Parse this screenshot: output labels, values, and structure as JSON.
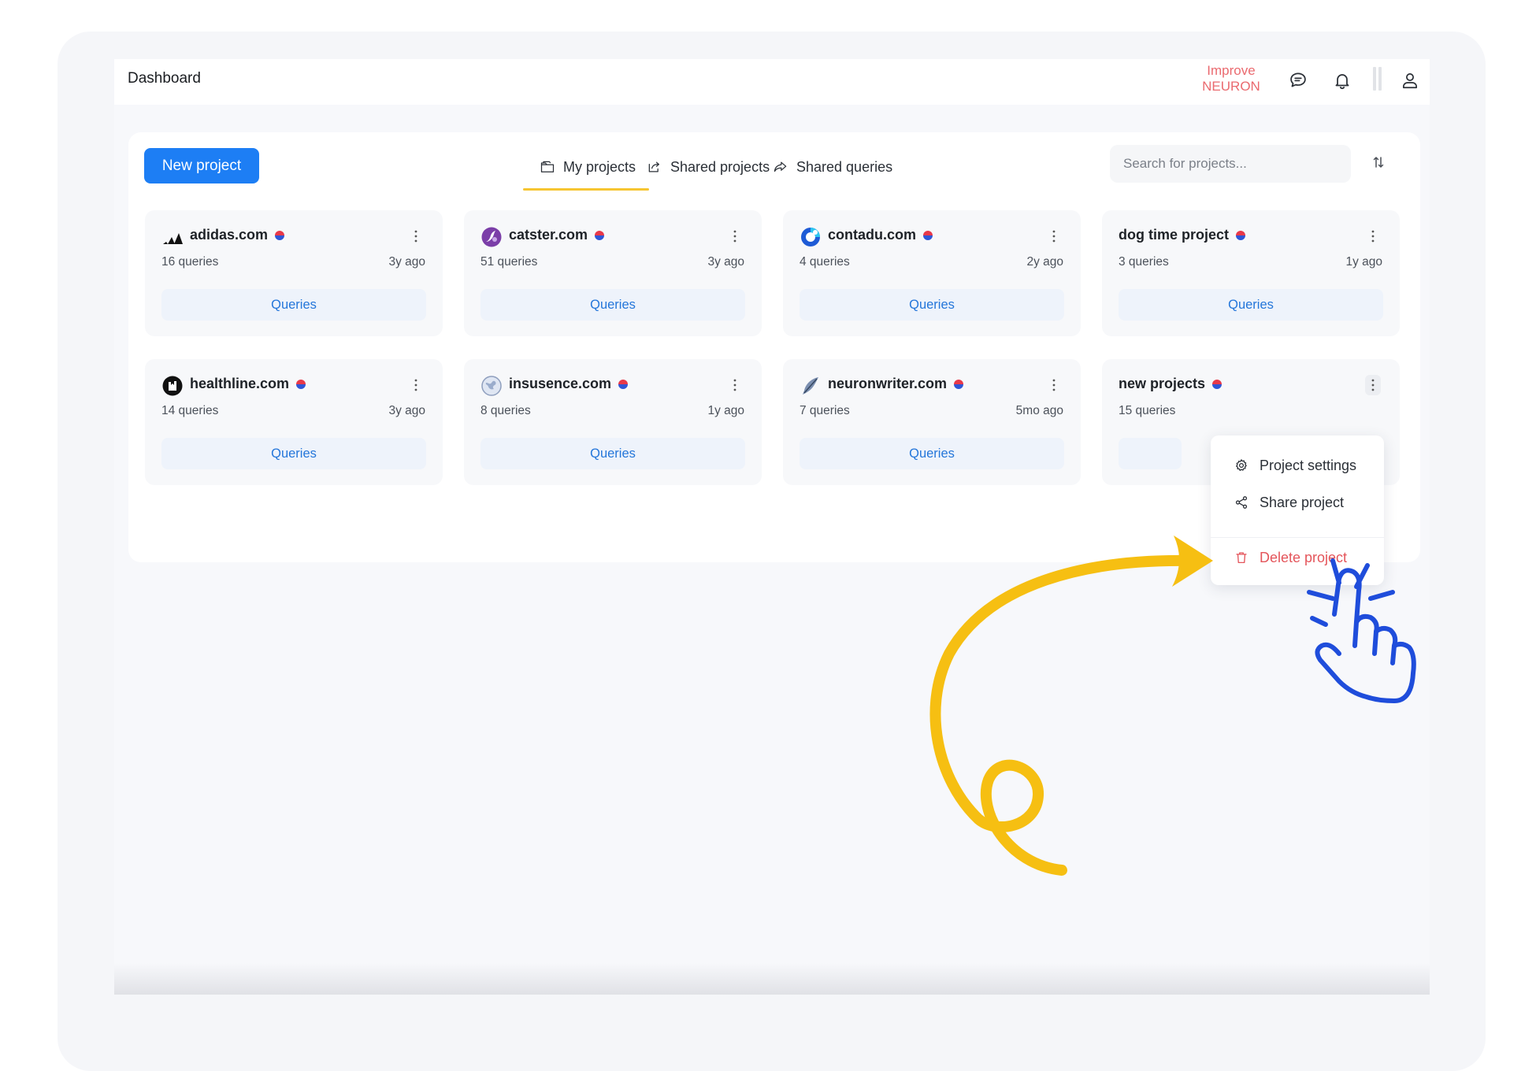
{
  "header": {
    "title": "Dashboard",
    "improve_line1": "Improve",
    "improve_line2": "NEURON"
  },
  "toolbar": {
    "new_project_label": "New project",
    "tabs": [
      {
        "label": "My projects",
        "icon": "folder-icon",
        "active": true
      },
      {
        "label": "Shared projects",
        "icon": "share-box-icon",
        "active": false
      },
      {
        "label": "Shared queries",
        "icon": "forward-arrow-icon",
        "active": false
      }
    ],
    "search_placeholder": "Search for projects..."
  },
  "projects": [
    {
      "name": "adidas.com",
      "queries": "16 queries",
      "ago": "3y ago",
      "button": "Queries",
      "icon": "adidas-logo"
    },
    {
      "name": "catster.com",
      "queries": "51 queries",
      "ago": "3y ago",
      "button": "Queries",
      "icon": "catster-logo"
    },
    {
      "name": "contadu.com",
      "queries": "4 queries",
      "ago": "2y ago",
      "button": "Queries",
      "icon": "contadu-logo"
    },
    {
      "name": "dog time project",
      "queries": "3 queries",
      "ago": "1y ago",
      "button": "Queries",
      "icon": ""
    },
    {
      "name": "healthline.com",
      "queries": "14 queries",
      "ago": "3y ago",
      "button": "Queries",
      "icon": "healthline-logo"
    },
    {
      "name": "insusence.com",
      "queries": "8 queries",
      "ago": "1y ago",
      "button": "Queries",
      "icon": "globe-logo"
    },
    {
      "name": "neuronwriter.com",
      "queries": "7 queries",
      "ago": "5mo ago",
      "button": "Queries",
      "icon": "feather-logo"
    },
    {
      "name": "new projects",
      "queries": "15 queries",
      "ago": "",
      "button": "",
      "icon": ""
    }
  ],
  "context_menu": {
    "items": [
      {
        "label": "Project settings",
        "icon": "gear-icon"
      },
      {
        "label": "Share project",
        "icon": "share-icon"
      },
      {
        "label": "Delete project",
        "icon": "trash-icon"
      }
    ]
  },
  "colors": {
    "primary": "#1d7ef4",
    "accent_tab": "#f6c531",
    "improve": "#ea6a6f",
    "danger": "#e4555b",
    "arrow": "#f6bf12",
    "hand": "#1f4ddb"
  }
}
